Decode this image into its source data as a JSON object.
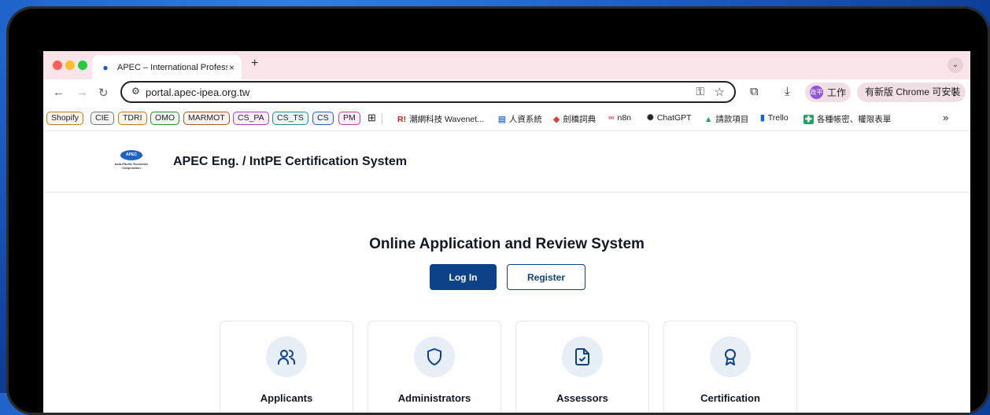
{
  "browser": {
    "tab_title": "APEC – International Professi",
    "tab_close": "×",
    "new_tab": "+",
    "tab_menu": "⌄",
    "url": "portal.apec-ipea.org.tw",
    "profile_label": "工作",
    "profile_initials": "政平",
    "update_label": "有新版 Chrome 可安裝",
    "update_menu": "⋮",
    "overflow": "»"
  },
  "bookmarks": {
    "chips": [
      {
        "label": "Shopify",
        "color": "#c07a17"
      },
      {
        "label": "CIE",
        "color": "#777777"
      },
      {
        "label": "TDRI",
        "color": "#c07a17"
      },
      {
        "label": "OMO",
        "color": "#2f8a3a"
      },
      {
        "label": "MARMOT",
        "color": "#b0552a"
      },
      {
        "label": "CS_PA",
        "color": "#b23bc4"
      },
      {
        "label": "CS_TS",
        "color": "#1d8f8a"
      },
      {
        "label": "CS",
        "color": "#2f5bd0"
      },
      {
        "label": "PM",
        "color": "#c43b9b"
      }
    ],
    "links": [
      {
        "label": "潮網科技 Wavenet...",
        "icon": "R!"
      },
      {
        "label": "人資系統",
        "icon": "▤"
      },
      {
        "label": "劍橋詞典",
        "icon": "◆"
      },
      {
        "label": "n8n",
        "icon": "∞"
      },
      {
        "label": "ChatGPT",
        "icon": "✺"
      },
      {
        "label": "請款項目",
        "icon": "▲"
      },
      {
        "label": "Trello",
        "icon": "▮"
      },
      {
        "label": "各種帳密、權限表單",
        "icon": "✚"
      }
    ]
  },
  "site": {
    "logo_mark": "APEC",
    "logo_caption": "Asia-Pacific Economic Cooperation",
    "title": "APEC Eng. / IntPE Certification System"
  },
  "hero": {
    "title": "Online Application and Review System",
    "login_label": "Log In",
    "register_label": "Register"
  },
  "cards": [
    {
      "label": "Applicants",
      "icon": "users-icon"
    },
    {
      "label": "Administrators",
      "icon": "shield-icon"
    },
    {
      "label": "Assessors",
      "icon": "file-check-icon"
    },
    {
      "label": "Certification",
      "icon": "award-icon"
    }
  ],
  "colors": {
    "primary": "#0c4287",
    "tabstrip": "#f8e4e9",
    "card_icon_bg": "#e8eef6"
  }
}
